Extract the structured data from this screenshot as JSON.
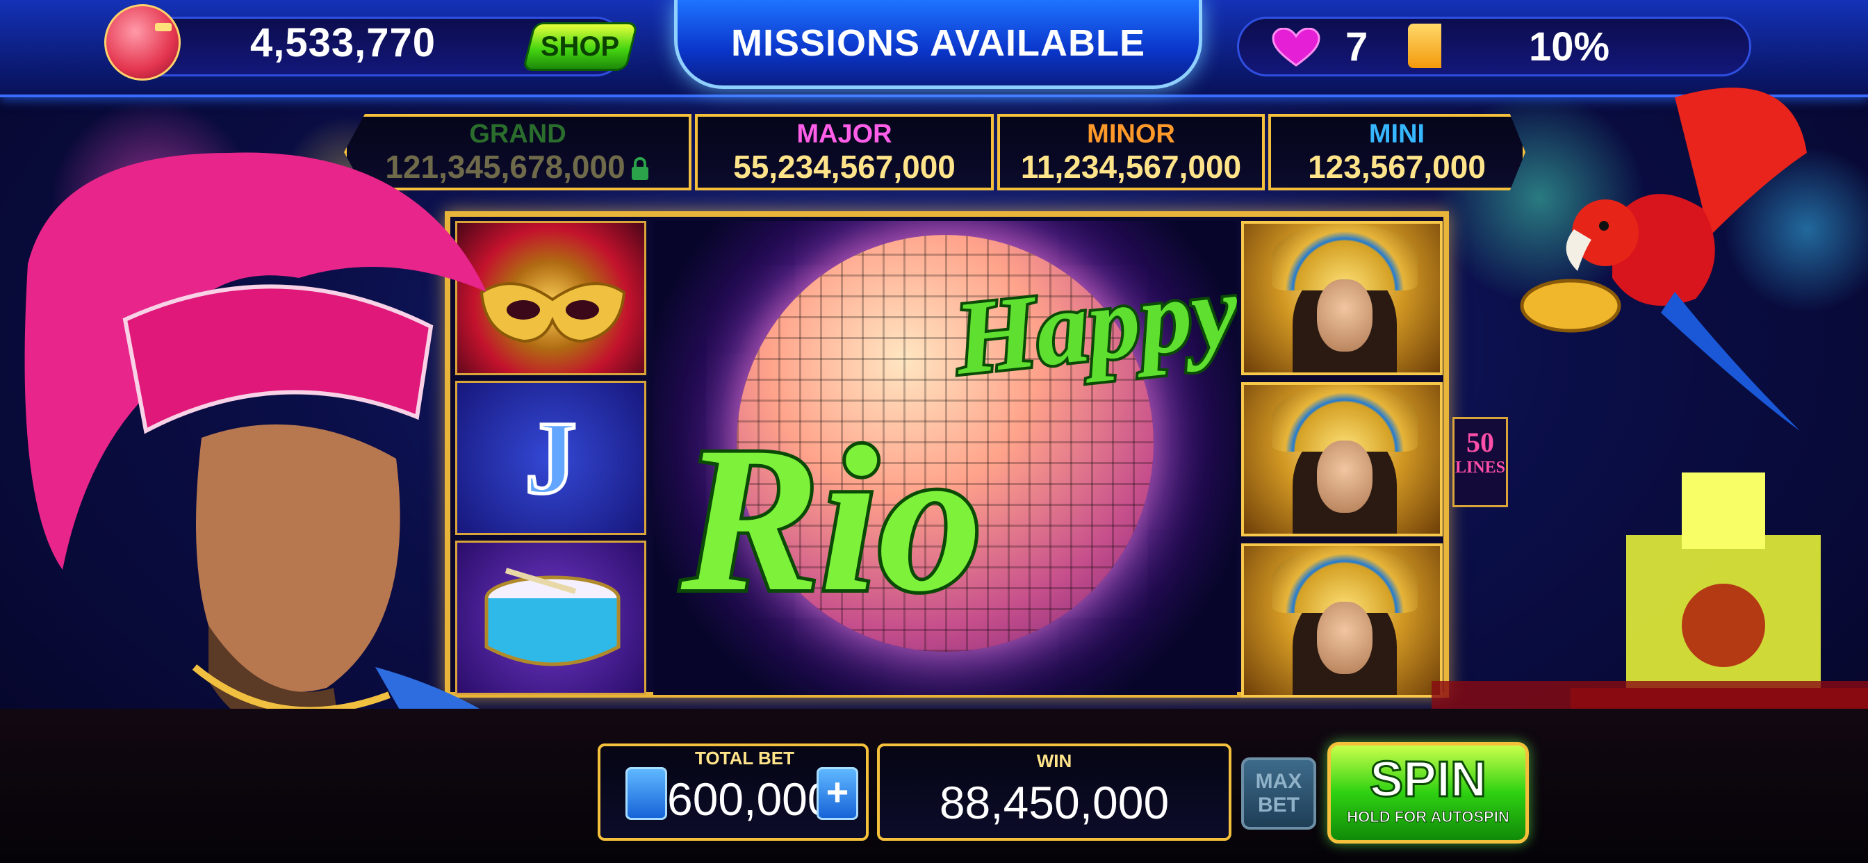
{
  "header": {
    "coins": "4,533,770",
    "shop_label": "SHOP",
    "missions_label": "MISSIONS AVAILABLE",
    "lives": "7",
    "level_progress": "10%",
    "level_progress_value": 0.1
  },
  "jackpots": [
    {
      "label": "GRAND",
      "value": "121,345,678,000",
      "locked": true,
      "color": "#2a6d2d"
    },
    {
      "label": "MAJOR",
      "value": "55,234,567,000",
      "color": "#ff5ee8"
    },
    {
      "label": "MINOR",
      "value": "11,234,567,000",
      "color": "#ff9a2a"
    },
    {
      "label": "MINI",
      "value": "123,567,000",
      "color": "#36b7ff"
    }
  ],
  "game": {
    "logo_line1": "Happy",
    "logo_line2": "Rio",
    "reel_left_symbols": [
      "mask-symbol",
      "J",
      "drum-symbol"
    ],
    "reel_right_symbols": [
      "queen-symbol",
      "queen-symbol",
      "queen-symbol"
    ],
    "lines_number": "50",
    "lines_label": "LINES"
  },
  "controls": {
    "total_bet_label": "TOTAL BET",
    "total_bet_value": "600,000",
    "win_label": "WIN",
    "win_value": "88,450,000",
    "max_bet_line1": "MAX",
    "max_bet_line2": "BET",
    "spin_label": "SPIN",
    "spin_sublabel": "HOLD FOR AUTOSPIN"
  },
  "icons": [
    "piggy-bank-icon",
    "heart-icon",
    "lock-icon",
    "plus-icon"
  ],
  "colors": {
    "accent_blue": "#1e73ff",
    "gold_border": "#f5c03b",
    "spin_green": "#2ed112",
    "heart_magenta": "#e51fd6"
  }
}
